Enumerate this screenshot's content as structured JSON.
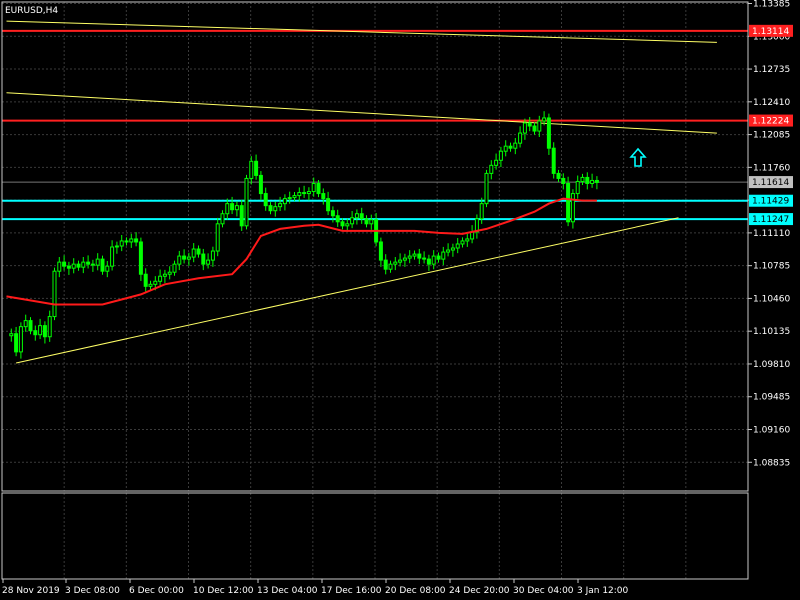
{
  "chart_title": "EURUSD,H4",
  "colors": {
    "background": "#000000",
    "grid": "#3a3a3a",
    "frame": "#c8c8c8",
    "text": "#ffffff",
    "candle": "#00ff00",
    "moving_average": "#ff1a1a",
    "resistance_line": "#ff2020",
    "support_line": "#00ffff",
    "trend_line": "#ffff66",
    "current_price_label": "#c0c0c0",
    "arrow": "#00ffff"
  },
  "chart_data": {
    "type": "candlestick",
    "symbol": "EURUSD",
    "timeframe": "H4",
    "ylim": [
      1.0855,
      1.134
    ],
    "y_ticks": [
      "1.13385",
      "1.13060",
      "1.12735",
      "1.12410",
      "1.12085",
      "1.11760",
      "1.11435",
      "1.11110",
      "1.10785",
      "1.10460",
      "1.10135",
      "1.09810",
      "1.09485",
      "1.09160",
      "1.08835"
    ],
    "x_ticks": [
      "28 Nov 2019",
      "3 Dec 08:00",
      "6 Dec 00:00",
      "10 Dec 12:00",
      "13 Dec 04:00",
      "17 Dec 16:00",
      "20 Dec 08:00",
      "24 Dec 20:00",
      "30 Dec 04:00",
      "3 Jan 12:00"
    ],
    "current_price": "1.11614",
    "horizontal_levels": [
      {
        "label": "1.13114",
        "value": 1.13114,
        "role": "resistance"
      },
      {
        "label": "1.12224",
        "value": 1.12224,
        "role": "resistance"
      },
      {
        "label": "1.11429",
        "value": 1.11429,
        "role": "support"
      },
      {
        "label": "1.11247",
        "value": 1.11247,
        "role": "support"
      }
    ],
    "trend_lines": [
      {
        "role": "ascending support",
        "from": {
          "bar": 2,
          "price": 1.0982
        },
        "to": {
          "bar": 140,
          "price": 1.1126
        }
      },
      {
        "role": "descending resistance",
        "from": {
          "bar": 0,
          "price": 1.125
        },
        "to": {
          "bar": 148,
          "price": 1.121
        }
      },
      {
        "role": "descending resistance",
        "from": {
          "bar": 0,
          "price": 1.1321
        },
        "to": {
          "bar": 148,
          "price": 1.13
        }
      }
    ],
    "close_path": [
      [
        0,
        1.1009
      ],
      [
        1,
        1.1011
      ],
      [
        2,
        1.0993
      ],
      [
        3,
        1.1018
      ],
      [
        4,
        1.1024
      ],
      [
        5,
        1.1014
      ],
      [
        6,
        1.101
      ],
      [
        7,
        1.1019
      ],
      [
        8,
        1.1008
      ],
      [
        9,
        1.1028
      ],
      [
        10,
        1.1073
      ],
      [
        11,
        1.1082
      ],
      [
        12,
        1.1078
      ],
      [
        13,
        1.1076
      ],
      [
        14,
        1.108
      ],
      [
        15,
        1.1077
      ],
      [
        16,
        1.1082
      ],
      [
        17,
        1.108
      ],
      [
        18,
        1.1079
      ],
      [
        19,
        1.1085
      ],
      [
        20,
        1.1073
      ],
      [
        21,
        1.1078
      ],
      [
        22,
        1.1097
      ],
      [
        23,
        1.1098
      ],
      [
        24,
        1.1103
      ],
      [
        25,
        1.1102
      ],
      [
        26,
        1.1105
      ],
      [
        27,
        1.1102
      ],
      [
        28,
        1.107
      ],
      [
        29,
        1.1058
      ],
      [
        30,
        1.106
      ],
      [
        31,
        1.1063
      ],
      [
        32,
        1.1068
      ],
      [
        33,
        1.107
      ],
      [
        34,
        1.1072
      ],
      [
        35,
        1.108
      ],
      [
        36,
        1.1088
      ],
      [
        37,
        1.1085
      ],
      [
        38,
        1.1087
      ],
      [
        39,
        1.1095
      ],
      [
        40,
        1.109
      ],
      [
        41,
        1.108
      ],
      [
        42,
        1.1084
      ],
      [
        43,
        1.1093
      ],
      [
        44,
        1.112
      ],
      [
        45,
        1.113
      ],
      [
        46,
        1.114
      ],
      [
        47,
        1.1134
      ],
      [
        48,
        1.1138
      ],
      [
        49,
        1.1118
      ],
      [
        50,
        1.1165
      ],
      [
        51,
        1.1182
      ],
      [
        52,
        1.1168
      ],
      [
        53,
        1.115
      ],
      [
        54,
        1.1138
      ],
      [
        55,
        1.1133
      ],
      [
        56,
        1.1137
      ],
      [
        57,
        1.114
      ],
      [
        58,
        1.1145
      ],
      [
        59,
        1.1146
      ],
      [
        60,
        1.1148
      ],
      [
        61,
        1.1151
      ],
      [
        62,
        1.115
      ],
      [
        63,
        1.1152
      ],
      [
        64,
        1.116
      ],
      [
        65,
        1.115
      ],
      [
        66,
        1.1145
      ],
      [
        67,
        1.1133
      ],
      [
        68,
        1.1128
      ],
      [
        69,
        1.1122
      ],
      [
        70,
        1.1118
      ],
      [
        71,
        1.112
      ],
      [
        72,
        1.1126
      ],
      [
        73,
        1.113
      ],
      [
        74,
        1.1125
      ],
      [
        75,
        1.112
      ],
      [
        76,
        1.1124
      ],
      [
        77,
        1.1102
      ],
      [
        78,
        1.1084
      ],
      [
        79,
        1.1075
      ],
      [
        80,
        1.108
      ],
      [
        81,
        1.1082
      ],
      [
        82,
        1.1084
      ],
      [
        83,
        1.1086
      ],
      [
        84,
        1.1088
      ],
      [
        85,
        1.109
      ],
      [
        86,
        1.1086
      ],
      [
        87,
        1.1085
      ],
      [
        88,
        1.108
      ],
      [
        89,
        1.1088
      ],
      [
        90,
        1.1085
      ],
      [
        91,
        1.1092
      ],
      [
        92,
        1.1094
      ],
      [
        93,
        1.1096
      ],
      [
        94,
        1.11
      ],
      [
        95,
        1.1103
      ],
      [
        96,
        1.1105
      ],
      [
        97,
        1.1112
      ],
      [
        98,
        1.1125
      ],
      [
        99,
        1.114
      ],
      [
        100,
        1.117
      ],
      [
        101,
        1.1178
      ],
      [
        102,
        1.1183
      ],
      [
        103,
        1.1192
      ],
      [
        104,
        1.1197
      ],
      [
        105,
        1.1195
      ],
      [
        106,
        1.12
      ],
      [
        107,
        1.121
      ],
      [
        108,
        1.122
      ],
      [
        109,
        1.1217
      ],
      [
        110,
        1.1212
      ],
      [
        111,
        1.1222
      ],
      [
        112,
        1.1225
      ],
      [
        113,
        1.1195
      ],
      [
        114,
        1.117
      ],
      [
        115,
        1.1165
      ],
      [
        116,
        1.116
      ],
      [
        117,
        1.1122
      ],
      [
        118,
        1.115
      ],
      [
        119,
        1.1162
      ],
      [
        120,
        1.1166
      ],
      [
        121,
        1.116
      ],
      [
        122,
        1.1163
      ],
      [
        123,
        1.1161
      ]
    ],
    "moving_average": [
      [
        0,
        1.1048
      ],
      [
        10,
        1.104
      ],
      [
        20,
        1.104
      ],
      [
        28,
        1.105
      ],
      [
        33,
        1.106
      ],
      [
        40,
        1.1066
      ],
      [
        47,
        1.107
      ],
      [
        50,
        1.1085
      ],
      [
        53,
        1.1108
      ],
      [
        57,
        1.1115
      ],
      [
        62,
        1.1118
      ],
      [
        65,
        1.1119
      ],
      [
        70,
        1.1113
      ],
      [
        75,
        1.1113
      ],
      [
        80,
        1.1113
      ],
      [
        85,
        1.1113
      ],
      [
        90,
        1.1111
      ],
      [
        95,
        1.111
      ],
      [
        100,
        1.1115
      ],
      [
        105,
        1.1123
      ],
      [
        110,
        1.1132
      ],
      [
        113,
        1.114
      ],
      [
        116,
        1.1145
      ],
      [
        120,
        1.1143
      ],
      [
        123,
        1.1143
      ]
    ]
  }
}
